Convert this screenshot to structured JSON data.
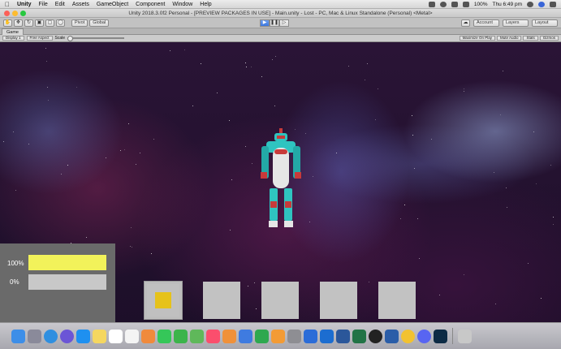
{
  "menubar": {
    "apple": "",
    "items": [
      "Unity",
      "File",
      "Edit",
      "Assets",
      "GameObject",
      "Component",
      "Window",
      "Help"
    ],
    "clock": "Thu 6:49 pm",
    "battery": "100%"
  },
  "window": {
    "title": "Unity 2018.3.0f2 Personal - [PREVIEW PACKAGES IN USE] - Main.unity - Lost - PC, Mac & Linux Standalone (Personal) <Metal>"
  },
  "toolbar": {
    "pivot": "Pivot",
    "global": "Global",
    "account": "Account",
    "layers": "Layers",
    "layout": "Layout"
  },
  "game_view": {
    "tab": "Game",
    "display": "Display 1",
    "aspect": "Free Aspect",
    "scale": "Scale",
    "maximize": "Maximize On Play",
    "mute": "Mute Audio",
    "stats": "Stats",
    "gizmos": "Gizmos"
  },
  "hud": {
    "bars": [
      {
        "label": "100%",
        "fraction": 1.0
      },
      {
        "label": "0%",
        "fraction": 0.0
      }
    ],
    "fill_color": "#f2f25a",
    "track_color": "#c8c8c8"
  },
  "inventory": {
    "slots": [
      {
        "filled": true,
        "selected": true,
        "item_color": "#e6c21a"
      },
      {
        "filled": false,
        "selected": false
      },
      {
        "filled": false,
        "selected": false
      },
      {
        "filled": false,
        "selected": false
      },
      {
        "filled": false,
        "selected": false
      }
    ]
  },
  "dock": {
    "icons": [
      "finder",
      "launchpad",
      "safari",
      "siri",
      "app-store",
      "notes",
      "calendar",
      "reminders",
      "photos",
      "messages",
      "facetime",
      "maps",
      "music",
      "books",
      "keynote",
      "numbers",
      "pages",
      "preferences",
      "xcode",
      "outlook",
      "word",
      "excel",
      "unity",
      "sourcetree",
      "chrome",
      "discord",
      "photoshop",
      "trash"
    ]
  }
}
